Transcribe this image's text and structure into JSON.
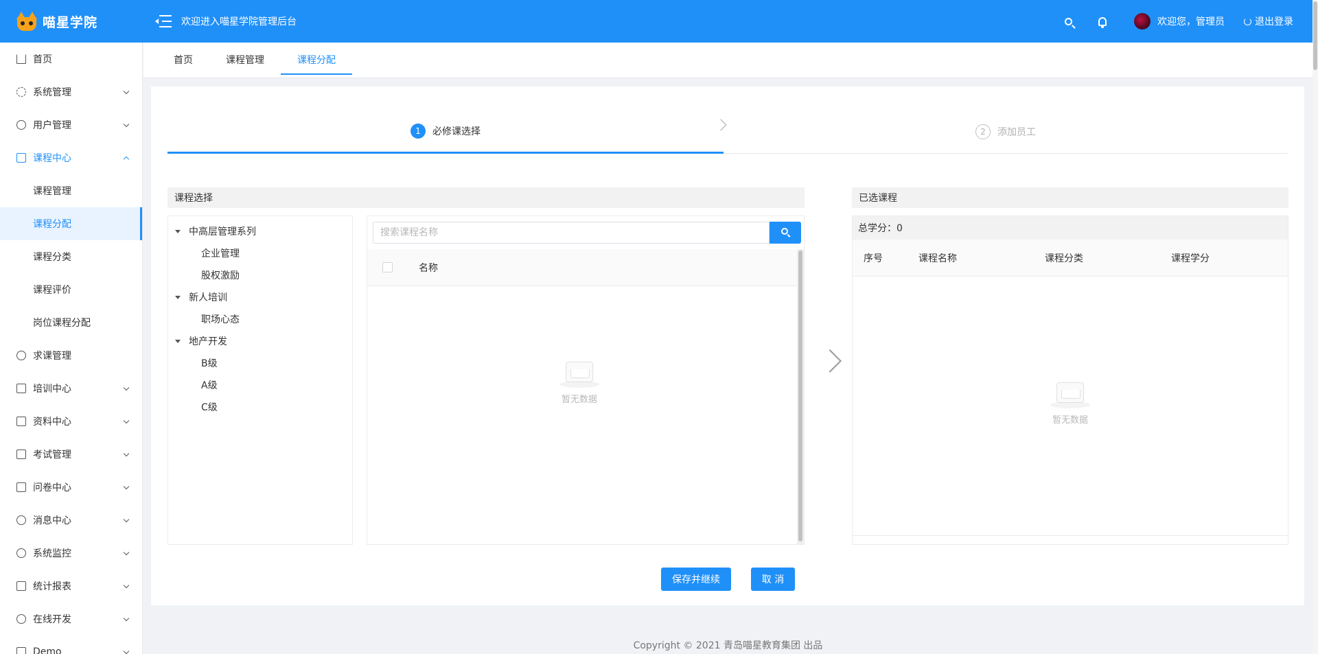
{
  "header": {
    "brand": "喵星学院",
    "welcome": "欢迎进入喵星学院管理后台",
    "user": "欢迎您，管理员",
    "logout": "退出登录"
  },
  "sidebar": {
    "items": [
      {
        "label": "首页"
      },
      {
        "label": "系统管理"
      },
      {
        "label": "用户管理"
      },
      {
        "label": "课程中心"
      },
      {
        "label": "求课管理"
      },
      {
        "label": "培训中心"
      },
      {
        "label": "资料中心"
      },
      {
        "label": "考试管理"
      },
      {
        "label": "问卷中心"
      },
      {
        "label": "消息中心"
      },
      {
        "label": "系统监控"
      },
      {
        "label": "统计报表"
      },
      {
        "label": "在线开发"
      },
      {
        "label": "Demo"
      }
    ],
    "course_sub": [
      {
        "label": "课程管理"
      },
      {
        "label": "课程分配"
      },
      {
        "label": "课程分类"
      },
      {
        "label": "课程评价"
      },
      {
        "label": "岗位课程分配"
      }
    ]
  },
  "tabs": [
    {
      "label": "首页"
    },
    {
      "label": "课程管理"
    },
    {
      "label": "课程分配"
    }
  ],
  "steps": [
    {
      "num": "1",
      "label": "必修课选择"
    },
    {
      "num": "2",
      "label": "添加员工"
    }
  ],
  "left_panel": {
    "title": "课程选择",
    "tree": [
      {
        "label": "中高层管理系列",
        "children": [
          "企业管理",
          "股权激励"
        ]
      },
      {
        "label": "新人培训",
        "children": [
          "职场心态"
        ]
      },
      {
        "label": "地产开发",
        "children": [
          "B级",
          "A级",
          "C级"
        ]
      }
    ],
    "search_placeholder": "搜索课程名称",
    "column_name": "名称",
    "empty": "暂无数据"
  },
  "right_panel": {
    "title": "已选课程",
    "total_credits": "总学分：0",
    "columns": [
      "序号",
      "课程名称",
      "课程分类",
      "课程学分"
    ],
    "empty": "暂无数据"
  },
  "buttons": {
    "save": "保存并继续",
    "cancel": "取 消"
  },
  "footer": "Copyright © 2021 青岛喵星教育集团 出品",
  "colors": {
    "primary": "#2090f9",
    "logo": "#f7a21b"
  }
}
